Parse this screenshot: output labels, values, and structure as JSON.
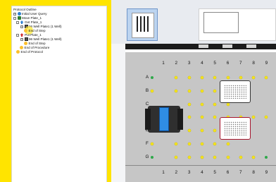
{
  "tree": {
    "items": [
      {
        "label": "Protocol Outline",
        "icon": "none",
        "expander": ""
      },
      {
        "label": "Initial User Query",
        "icon": "query-icon",
        "expander": "+"
      },
      {
        "label": "Move Plate_1",
        "icon": "move-icon",
        "expander": "-"
      },
      {
        "label": "Get Plate_1",
        "icon": "get-plate-icon",
        "expander": "-"
      },
      {
        "label": "96 Well Plate1 (1 Well)",
        "icon": "plate-icon",
        "expander": "+"
      },
      {
        "label": "End of Step",
        "icon": "end-step-icon",
        "expander": ""
      },
      {
        "label": "Put Plate_1",
        "icon": "put-plate-icon",
        "expander": "-"
      },
      {
        "label": "96 Well Plate1 (1 Well)",
        "icon": "plate-icon",
        "expander": "+"
      },
      {
        "label": "End of Step",
        "icon": "end-step-icon",
        "expander": ""
      },
      {
        "label": "End of Procedure",
        "icon": "end-procedure-icon",
        "expander": ""
      },
      {
        "label": "End of Protocol",
        "icon": "end-protocol-icon",
        "expander": ""
      }
    ]
  },
  "deck": {
    "columns": [
      "1",
      "2",
      "3",
      "4",
      "5",
      "6",
      "7",
      "8",
      "9"
    ],
    "rows": [
      "A",
      "B",
      "C",
      "D",
      "E",
      "F",
      "G"
    ]
  },
  "colors": {
    "frame": "#ffe400",
    "dot": "#f2e21c",
    "dot_active": "#2ea84a",
    "gripper_accent": "#2f8de4",
    "plate_selected": "#a5142c"
  }
}
